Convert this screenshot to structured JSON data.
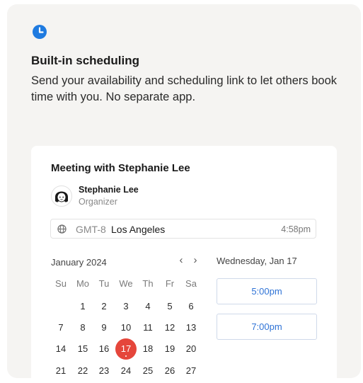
{
  "feature": {
    "icon": "clock-icon",
    "title": "Built-in scheduling",
    "description": "Send your availability and scheduling link to let others book time with you. No separate app."
  },
  "meeting": {
    "title": "Meeting with Stephanie Lee",
    "organizer_name": "Stephanie Lee",
    "organizer_role": "Organizer",
    "timezone_offset": "GMT-8",
    "timezone_city": "Los Angeles",
    "current_time": "4:58pm"
  },
  "calendar": {
    "month_label": "January 2024",
    "prev": "‹",
    "next": "›",
    "weekdays": [
      "Su",
      "Mo",
      "Tu",
      "We",
      "Th",
      "Fr",
      "Sa"
    ],
    "weeks": [
      [
        "",
        "1",
        "2",
        "3",
        "4",
        "5",
        "6"
      ],
      [
        "7",
        "8",
        "9",
        "10",
        "11",
        "12",
        "13"
      ],
      [
        "14",
        "15",
        "16",
        "17",
        "18",
        "19",
        "20"
      ],
      [
        "21",
        "22",
        "23",
        "24",
        "25",
        "26",
        "27"
      ]
    ],
    "selected_day": "17"
  },
  "slots": {
    "date_label": "Wednesday, Jan 17",
    "times": [
      "5:00pm",
      "7:00pm"
    ]
  },
  "colors": {
    "accent_blue": "#2f73d6",
    "selected_red": "#e5463b",
    "icon_blue": "#1f7be0"
  }
}
